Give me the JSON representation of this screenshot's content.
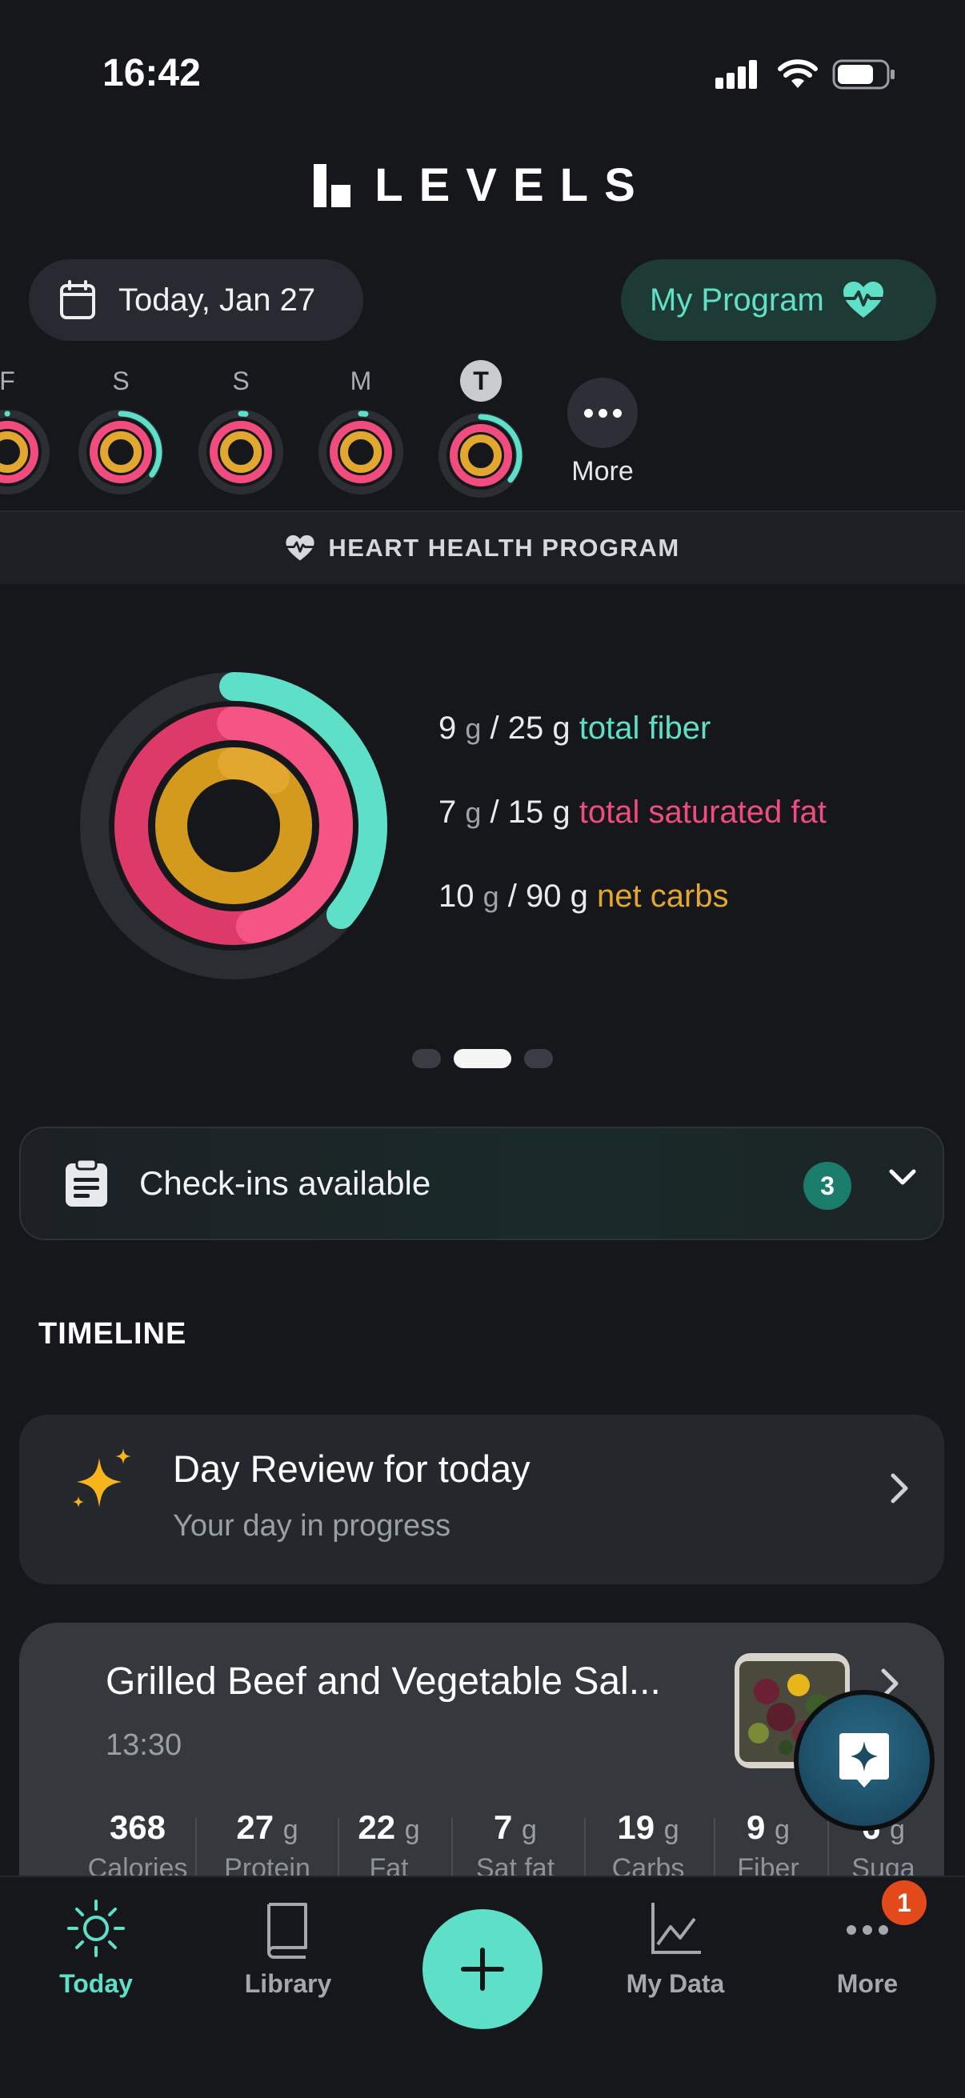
{
  "status_bar": {
    "time": "16:42"
  },
  "app": {
    "logo_text": "LEVELS"
  },
  "header": {
    "date_label": "Today, Jan 27",
    "program_label": "My Program"
  },
  "days": [
    {
      "letter": "F",
      "fiber": 0.0
    },
    {
      "letter": "S",
      "fiber": 0.35
    },
    {
      "letter": "S",
      "fiber": 0.02
    },
    {
      "letter": "M",
      "fiber": 0.02
    },
    {
      "letter": "T",
      "fiber": 0.36,
      "today": true
    }
  ],
  "days_more_label": "More",
  "program_banner": "HEART HEALTH PROGRAM",
  "rings": {
    "fiber": {
      "value": "9",
      "unit": "g",
      "goal": "25 g",
      "label": "total fiber",
      "progress": 0.36
    },
    "sat_fat": {
      "value": "7",
      "unit": "g",
      "goal": "15 g",
      "label": "total saturated fat",
      "progress": 0.47
    },
    "net_carbs": {
      "value": "10",
      "unit": "g",
      "goal": "90 g",
      "label": "net carbs",
      "progress": 0.11
    }
  },
  "pager": {
    "count": 3,
    "active": 1
  },
  "checkins": {
    "title": "Check-ins available",
    "count": "3"
  },
  "timeline": {
    "heading": "TIMELINE",
    "review": {
      "title": "Day Review for today",
      "subtitle": "Your day in progress"
    },
    "meal": {
      "title": "Grilled Beef and Vegetable Sal...",
      "time": "13:30",
      "nutrients": [
        {
          "value": "368",
          "unit": "",
          "label": "Calories"
        },
        {
          "value": "27",
          "unit": "g",
          "label": "Protein"
        },
        {
          "value": "22",
          "unit": "g",
          "label": "Fat"
        },
        {
          "value": "7",
          "unit": "g",
          "label": "Sat fat"
        },
        {
          "value": "19",
          "unit": "g",
          "label": "Carbs"
        },
        {
          "value": "9",
          "unit": "g",
          "label": "Fiber"
        },
        {
          "value": "6",
          "unit": "g",
          "label": "Suga"
        }
      ]
    }
  },
  "nav": {
    "today": "Today",
    "library": "Library",
    "my_data": "My Data",
    "more": "More",
    "more_badge": "1"
  },
  "colors": {
    "fiber": "#5ee0c8",
    "sat_fat": "#f04d7e",
    "carbs": "#e2a72e",
    "background": "#15171b"
  }
}
